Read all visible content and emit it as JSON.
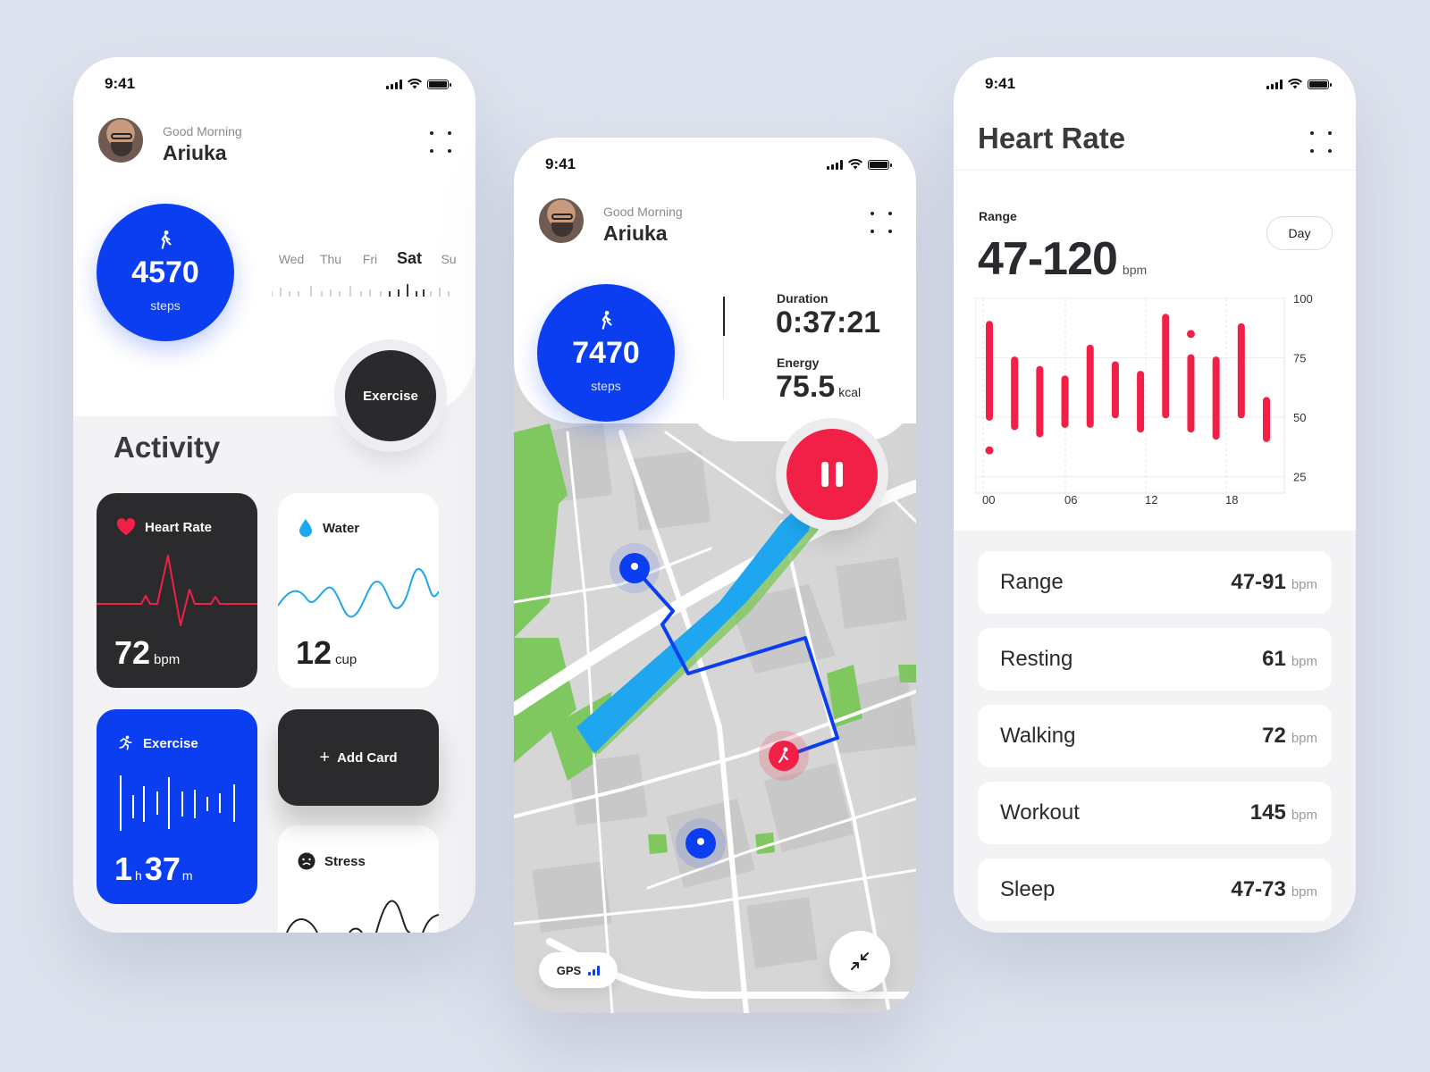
{
  "colors": {
    "blue": "#0a3ef0",
    "red": "#f21f46",
    "dark": "#2b2b2d",
    "water": "#1ea7f0",
    "bg": "#dde3ee"
  },
  "phone1": {
    "time": "9:41",
    "greeting": "Good Morning",
    "name": "Ariuka",
    "steps": {
      "value": "4570",
      "label": "steps"
    },
    "days": [
      "Wed",
      "Thu",
      "Fri",
      "Sat",
      "Su"
    ],
    "selected_day": "Sat",
    "exercise_button": "Exercise",
    "section_title": "Activity",
    "cards": {
      "heart": {
        "title": "Heart Rate",
        "value": "72",
        "unit": "bpm",
        "icon": "heart-icon"
      },
      "water": {
        "title": "Water",
        "value": "12",
        "unit": "cup",
        "icon": "water-drop-icon"
      },
      "exercise": {
        "title": "Exercise",
        "hours": "1",
        "h": "h",
        "minutes": "37",
        "m": "m",
        "icon": "running-icon"
      },
      "add": {
        "label": "Add Card",
        "icon": "plus-icon"
      },
      "stress": {
        "title": "Stress",
        "icon": "sad-face-icon"
      }
    }
  },
  "phone2": {
    "time": "9:41",
    "greeting": "Good Morning",
    "name": "Ariuka",
    "steps": {
      "value": "7470",
      "label": "steps"
    },
    "duration_label": "Duration",
    "duration_value": "0:37:21",
    "energy_label": "Energy",
    "energy_value": "75.5",
    "energy_unit": "kcal",
    "gps_label": "GPS",
    "icons": [
      "pause-icon",
      "collapse-icon",
      "gps-signal-icon",
      "location-pin-icon"
    ]
  },
  "phone3": {
    "time": "9:41",
    "title": "Heart Rate",
    "range_label": "Range",
    "range_value": "47-120",
    "range_unit": "bpm",
    "period": "Day",
    "stats": [
      {
        "label": "Range",
        "value": "47-91",
        "unit": "bpm"
      },
      {
        "label": "Resting",
        "value": "61",
        "unit": "bpm"
      },
      {
        "label": "Walking",
        "value": "72",
        "unit": "bpm"
      },
      {
        "label": "Workout",
        "value": "145",
        "unit": "bpm"
      },
      {
        "label": "Sleep",
        "value": "47-73",
        "unit": "bpm"
      }
    ]
  },
  "chart_data": {
    "type": "bar",
    "title": "",
    "x_ticks": [
      "00",
      "06",
      "12",
      "18"
    ],
    "y_ticks": [
      "25",
      "50",
      "75",
      "100"
    ],
    "ylim": [
      18,
      100
    ],
    "grid": true,
    "color": "#f21f46",
    "series": [
      {
        "values": [
          [
            50,
            89
          ],
          [
            46,
            74
          ],
          [
            43,
            70
          ],
          [
            47,
            66
          ],
          [
            47,
            79
          ],
          [
            51,
            72
          ],
          [
            45,
            68
          ],
          [
            51,
            92
          ],
          [
            45,
            75
          ],
          [
            42,
            74
          ],
          [
            51,
            88
          ],
          [
            41,
            57
          ]
        ]
      }
    ],
    "extra_points": [
      [
        36
      ],
      [],
      [],
      [],
      [],
      [],
      [],
      [],
      [
        85
      ],
      [],
      [],
      []
    ]
  }
}
